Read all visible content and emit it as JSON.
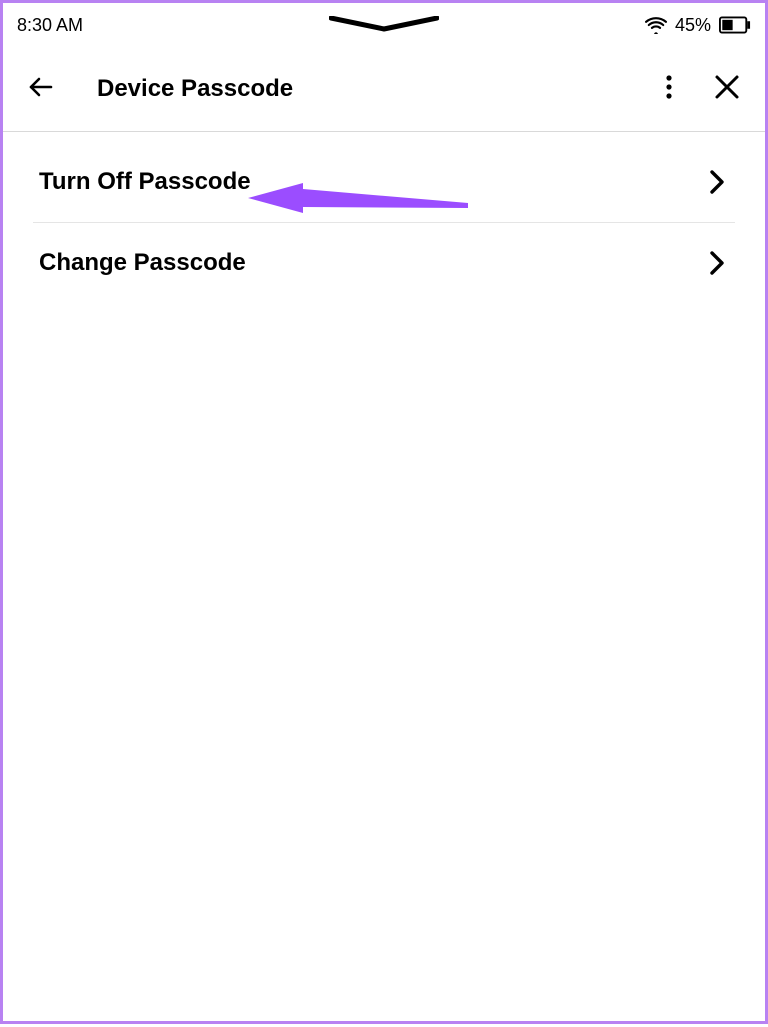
{
  "status": {
    "time": "8:30 AM",
    "battery_pct": "45%"
  },
  "header": {
    "title": "Device Passcode"
  },
  "list": {
    "items": [
      {
        "label": "Turn Off Passcode"
      },
      {
        "label": "Change Passcode"
      }
    ]
  },
  "annotation": {
    "color": "#9b4dff"
  }
}
